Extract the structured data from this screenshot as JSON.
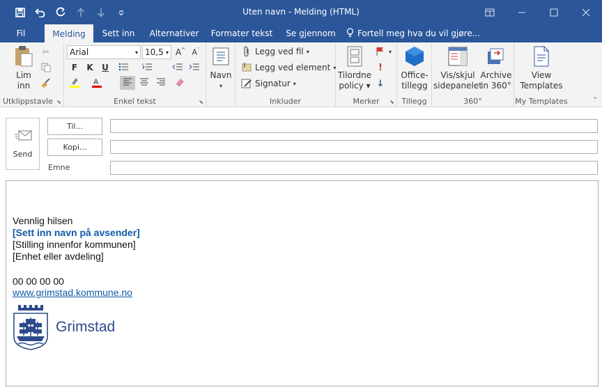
{
  "window": {
    "title": "Uten navn - Melding (HTML)",
    "qat": {
      "save": "save-icon",
      "undo": "undo-icon",
      "redo": "redo-icon",
      "up": "up-arrow-icon",
      "down": "down-arrow-icon",
      "more": "customize-icon"
    },
    "controls": {
      "restore": "❐",
      "minimize": "—",
      "maximize": "☐",
      "close": "✕"
    }
  },
  "tabs": [
    "Fil",
    "Melding",
    "Sett inn",
    "Alternativer",
    "Formater tekst",
    "Se gjennom",
    "Fortell meg hva du vil gjøre..."
  ],
  "ribbon": {
    "clipboard": {
      "paste_label": "Lim",
      "paste_label2": "inn",
      "group": "Utklippstavle"
    },
    "text": {
      "font": "Arial",
      "size": "10,5",
      "bold": "F",
      "italic": "K",
      "underline": "U",
      "group": "Enkel tekst"
    },
    "names": {
      "label": "Navn"
    },
    "include": {
      "attach": "Legg ved fil",
      "item": "Legg ved element",
      "signature": "Signatur",
      "group": "Inkluder"
    },
    "tags": {
      "policy": "Tilordne",
      "policy2": "policy",
      "group": "Merker"
    },
    "addins": {
      "label": "Office-",
      "label2": "tillegg",
      "group": "Tillegg"
    },
    "pane": {
      "label": "Vis/skjul",
      "label2": "sidepanelet"
    },
    "archive": {
      "label": "Archive",
      "label2": "in 360°",
      "group": "360°"
    },
    "templates": {
      "label": "View",
      "label2": "Templates",
      "group": "My Templates"
    }
  },
  "compose": {
    "send": "Send",
    "to": "Til...",
    "cc": "Kopi...",
    "subject": "Emne"
  },
  "signature": {
    "greeting": "Vennlig hilsen",
    "name": "[Sett inn navn på avsender]",
    "position": "[Stilling innenfor kommunen]",
    "unit": "[Enhet eller avdeling]",
    "phone": "00 00 00 00",
    "web": "www.grimstad.kommune.no",
    "logo_text": "Grimstad"
  },
  "colors": {
    "accent": "#2b579a",
    "link": "#0f5aa8",
    "logo": "#2e4a8a"
  }
}
